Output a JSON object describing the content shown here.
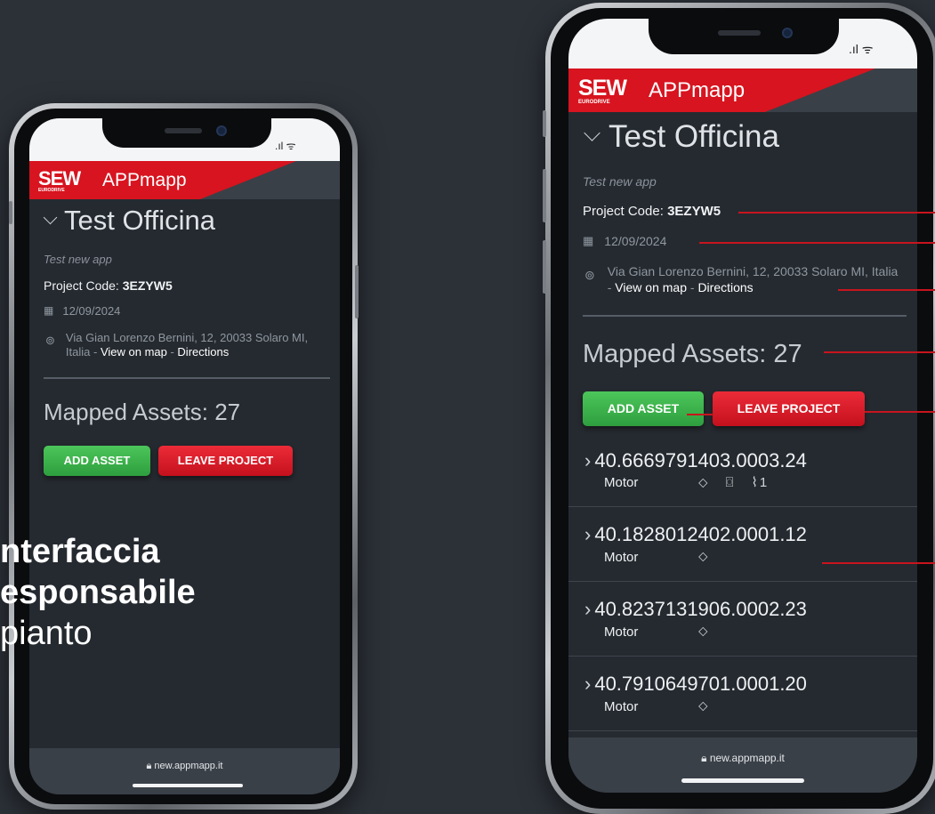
{
  "brand": {
    "logo_main": "SEW",
    "logo_sub": "EURODRIVE",
    "app_name": "APPmapp",
    "accent_red": "#d7141f",
    "accent_green": "#3cb54c"
  },
  "project": {
    "title": "Test Officina",
    "subtitle": "Test new app",
    "code_label": "Project Code:",
    "code_value": "3EZYW5",
    "date": "12/09/2024",
    "address": "Via Gian Lorenzo Bernini, 12, 20033 Solaro MI, Italia",
    "address_sep": " - ",
    "view_on_map": "View on map",
    "directions": "Directions"
  },
  "mapped": {
    "label": "Mapped Assets: 27"
  },
  "buttons": {
    "add_asset": "ADD ASSET",
    "leave_project": "LEAVE PROJECT"
  },
  "assets": [
    {
      "id": "40.6669791403.0003.24",
      "type": "Motor",
      "icons": [
        "tag-icon",
        "camera-icon",
        "paperclip-icon"
      ],
      "attachments": "1"
    },
    {
      "id": "40.1828012402.0001.12",
      "type": "Motor",
      "icons": [
        "tag-icon"
      ]
    },
    {
      "id": "40.8237131906.0002.23",
      "type": "Motor",
      "icons": [
        "tag-icon"
      ]
    },
    {
      "id": "40.7910649701.0001.20",
      "type": "Motor",
      "icons": [
        "tag-icon"
      ]
    }
  ],
  "browser": {
    "url": "new.appmapp.it"
  },
  "overlay": {
    "line1": "nterfaccia",
    "line2": "esponsabile",
    "line3": "pianto"
  }
}
